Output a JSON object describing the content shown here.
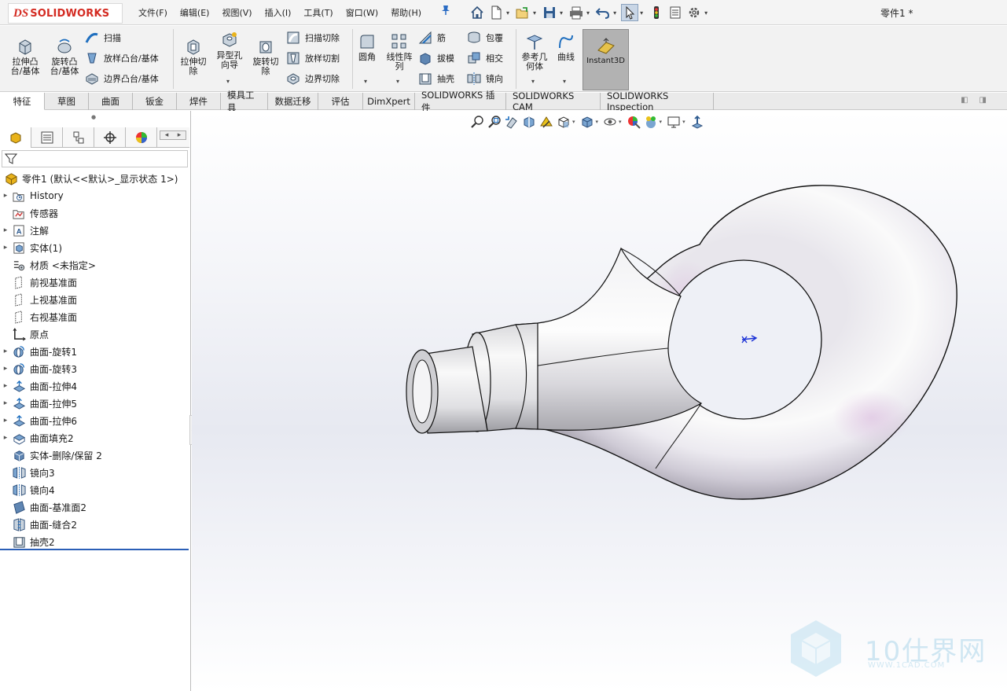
{
  "app": {
    "logo_ds": "DS",
    "logo_name": "SOLIDWORKS",
    "document_title": "零件1 *"
  },
  "menu": [
    "文件(F)",
    "编辑(E)",
    "视图(V)",
    "插入(I)",
    "工具(T)",
    "窗口(W)",
    "帮助(H)"
  ],
  "quickbar_icons": [
    "home-icon",
    "new-document-icon",
    "open-icon",
    "save-icon",
    "print-icon",
    "undo-icon",
    "select-icon",
    "rebuild-icon",
    "file-properties-icon",
    "options-icon"
  ],
  "ribbon": {
    "extrude_boss": "拉伸凸\n台/基体",
    "revolve_boss": "旋转凸\n台/基体",
    "sweep": "扫描",
    "loft_boss": "放样凸台/基体",
    "boundary_boss": "边界凸台/基体",
    "extrude_cut": "拉伸切\n除",
    "hole_wizard": "异型孔\n向导",
    "revolve_cut": "旋转切\n除",
    "swept_cut": "扫描切除",
    "lofted_cut": "放样切割",
    "boundary_cut": "边界切除",
    "fillet": "圆角",
    "linear_pattern": "线性阵\n列",
    "rib": "筋",
    "draft": "拔模",
    "shell": "抽壳",
    "wrap": "包覆",
    "intersect": "相交",
    "mirror": "镜向",
    "reference_geometry": "参考几\n何体",
    "curves": "曲线",
    "instant3d": "Instant3D"
  },
  "tabs": [
    "特征",
    "草图",
    "曲面",
    "钣金",
    "焊件",
    "模具工具",
    "数据迁移",
    "评估",
    "DimXpert",
    "SOLIDWORKS 插件",
    "SOLIDWORKS CAM",
    "SOLIDWORKS Inspection"
  ],
  "active_tab": "特征",
  "feature_tree": {
    "root": "零件1 (默认<<默认>_显示状态 1>)",
    "items": [
      {
        "label": "History",
        "icon": "history-folder-icon",
        "expandable": true
      },
      {
        "label": "传感器",
        "icon": "sensor-icon",
        "expandable": false
      },
      {
        "label": "注解",
        "icon": "annotation-icon",
        "expandable": true
      },
      {
        "label": "实体(1)",
        "icon": "solid-bodies-icon",
        "expandable": true
      },
      {
        "label": "材质 <未指定>",
        "icon": "material-icon",
        "expandable": false
      },
      {
        "label": "前视基准面",
        "icon": "plane-icon",
        "expandable": false
      },
      {
        "label": "上视基准面",
        "icon": "plane-icon",
        "expandable": false
      },
      {
        "label": "右视基准面",
        "icon": "plane-icon",
        "expandable": false
      },
      {
        "label": "原点",
        "icon": "origin-icon",
        "expandable": false
      },
      {
        "label": "曲面-旋转1",
        "icon": "surface-revolve-icon",
        "expandable": true
      },
      {
        "label": "曲面-旋转3",
        "icon": "surface-revolve-icon",
        "expandable": true
      },
      {
        "label": "曲面-拉伸4",
        "icon": "surface-extrude-icon",
        "expandable": true
      },
      {
        "label": "曲面-拉伸5",
        "icon": "surface-extrude-icon",
        "expandable": true
      },
      {
        "label": "曲面-拉伸6",
        "icon": "surface-extrude-icon",
        "expandable": true
      },
      {
        "label": "曲面填充2",
        "icon": "surface-fill-icon",
        "expandable": true
      },
      {
        "label": "实体-删除/保留 2",
        "icon": "delete-body-icon",
        "expandable": false
      },
      {
        "label": "镜向3",
        "icon": "mirror-icon",
        "expandable": false
      },
      {
        "label": "镜向4",
        "icon": "mirror-icon",
        "expandable": false
      },
      {
        "label": "曲面-基准面2",
        "icon": "planar-surface-icon",
        "expandable": false
      },
      {
        "label": "曲面-缝合2",
        "icon": "knit-surface-icon",
        "expandable": false
      },
      {
        "label": "抽壳2",
        "icon": "shell-icon",
        "expandable": false
      }
    ]
  },
  "heads_up_toolbar": [
    "zoom-to-fit-icon",
    "zoom-to-area-icon",
    "previous-view-icon",
    "section-view-icon",
    "dynamic-annotation-icon",
    "view-orientation-icon",
    "display-style-icon",
    "hide-show-icon",
    "edit-appearance-icon",
    "apply-scene-icon",
    "view-settings-icon",
    "rotate-icon"
  ],
  "watermark": {
    "text": "10仕界网",
    "url": "WWW.1CAD.COM"
  },
  "colors": {
    "logo_red": "#d42b22",
    "accent_blue": "#2b5fb7",
    "instant3d_active": "#b2b2b2"
  }
}
